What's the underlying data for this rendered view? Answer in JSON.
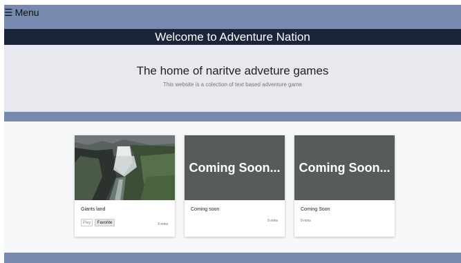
{
  "nav": {
    "menu_icon": "☰",
    "menu_label": "Menu"
  },
  "banner": {
    "title": "Welcome to Adventure Nation"
  },
  "hero": {
    "heading": "The home of naritve adveture games",
    "subheading": "This website is a colection of text based adventure game"
  },
  "cards": [
    {
      "title": "Giants land",
      "time": "9 mins",
      "play_label": "Play",
      "favorite_label": "Favorite",
      "image": "waterfall-landscape"
    },
    {
      "title": "Coming soon",
      "time": "9 mins",
      "overlay": "Coming Soon..."
    },
    {
      "title": "Coming Soon",
      "time": "9 mins",
      "overlay": "Coming Soon..."
    }
  ],
  "colors": {
    "accent_band": "#7889b0",
    "header_dark": "#1b2539",
    "hero_bg": "#e7e9ee",
    "placeholder": "#575b5c"
  }
}
